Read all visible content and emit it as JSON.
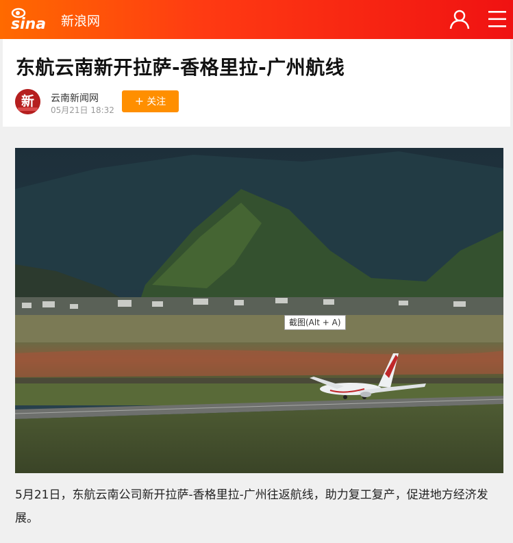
{
  "header": {
    "logo_text": "sina",
    "site_name": "新浪网",
    "icons": [
      "user-icon",
      "menu-icon"
    ],
    "accent_color": "#ff3a12"
  },
  "article": {
    "title": "东航云南新开拉萨-香格里拉-广州航线",
    "author": "云南新闻网",
    "avatar_char": "新",
    "date": "05月21日  18:32",
    "follow_label": "关注",
    "follow_color": "#ff8f00",
    "photo_tooltip": "截图(Alt + A)",
    "caption": "5月21日，东航云南公司新开拉萨-香格里拉-广州往返航线，助力复工复产，促进地方经济发展。"
  }
}
